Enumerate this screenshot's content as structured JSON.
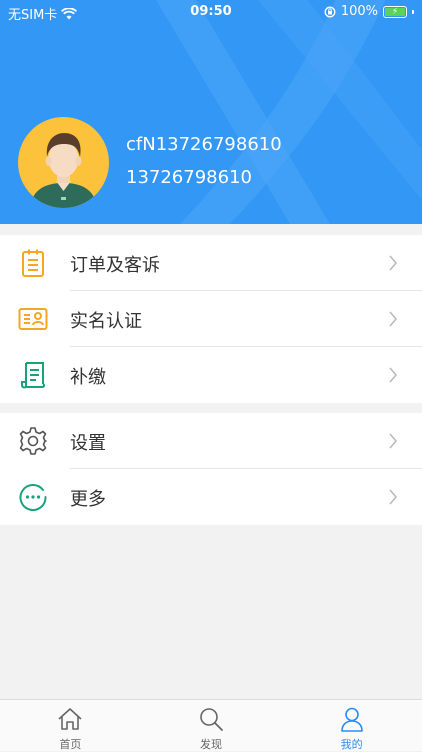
{
  "status_bar": {
    "carrier": "无SIM卡",
    "time": "09:50",
    "battery": "100%"
  },
  "profile": {
    "username": "cfN13726798610",
    "phone": "13726798610"
  },
  "menu_group_1": [
    {
      "label": "订单及客诉",
      "icon": "clipboard-icon"
    },
    {
      "label": "实名认证",
      "icon": "id-card-icon"
    },
    {
      "label": "补缴",
      "icon": "receipt-icon"
    }
  ],
  "menu_group_2": [
    {
      "label": "设置",
      "icon": "gear-icon"
    },
    {
      "label": "更多",
      "icon": "more-circle-icon"
    }
  ],
  "tabbar": {
    "items": [
      {
        "label": "首页",
        "icon": "home-icon"
      },
      {
        "label": "发现",
        "icon": "search-icon"
      },
      {
        "label": "我的",
        "icon": "person-icon"
      }
    ],
    "active": "我的"
  },
  "colors": {
    "header": "#3398f5",
    "avatar_bg": "#fcc23b",
    "orange": "#f5a623",
    "green": "#1aa37a",
    "active_tab": "#2d8cf0"
  }
}
